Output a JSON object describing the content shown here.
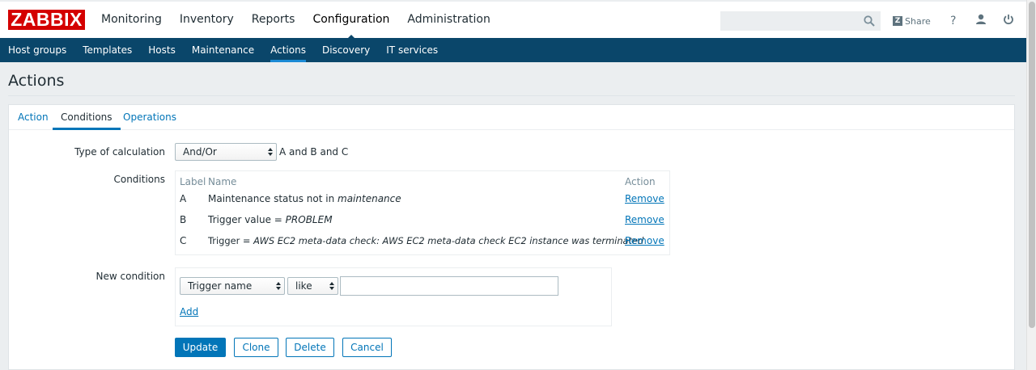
{
  "header": {
    "logo": "ZABBIX",
    "menu": [
      "Monitoring",
      "Inventory",
      "Reports",
      "Configuration",
      "Administration"
    ],
    "active_menu_index": 3,
    "search_placeholder": "",
    "share_label": "Share",
    "help_label": "?"
  },
  "submenu": {
    "items": [
      "Host groups",
      "Templates",
      "Hosts",
      "Maintenance",
      "Actions",
      "Discovery",
      "IT services"
    ],
    "active_index": 4
  },
  "page": {
    "title": "Actions"
  },
  "tabs": {
    "items": [
      "Action",
      "Conditions",
      "Operations"
    ],
    "active_index": 1
  },
  "form": {
    "calc_label": "Type of calculation",
    "calc_value": "And/Or",
    "calc_formula": "A and B and C",
    "conditions_label": "Conditions",
    "conditions_headers": {
      "label": "Label",
      "name": "Name",
      "action": "Action"
    },
    "conditions": [
      {
        "label": "A",
        "name_prefix": "Maintenance status not in ",
        "name_value": "maintenance",
        "action": "Remove"
      },
      {
        "label": "B",
        "name_prefix": "Trigger value = ",
        "name_value": "PROBLEM",
        "action": "Remove"
      },
      {
        "label": "C",
        "name_prefix": "Trigger = ",
        "name_value": "AWS EC2 meta-data check: AWS EC2 meta-data check EC2 instance was terminated",
        "action": "Remove"
      }
    ],
    "new_condition_label": "New condition",
    "new_condition_type": "Trigger name",
    "new_condition_operator": "like",
    "new_condition_value": "",
    "add_label": "Add"
  },
  "buttons": {
    "update": "Update",
    "clone": "Clone",
    "delete": "Delete",
    "cancel": "Cancel"
  },
  "colors": {
    "brand": "#d40000",
    "submenu_bg": "#0a466a",
    "link": "#0275b8"
  }
}
